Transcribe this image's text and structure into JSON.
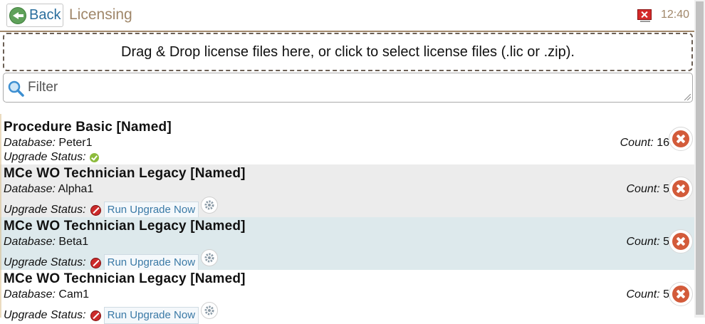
{
  "header": {
    "back_label": "Back",
    "title": "Licensing",
    "clock": "12:40"
  },
  "dropzone": {
    "text": "Drag & Drop license files here, or click to select license files (.lic or .zip)."
  },
  "filter": {
    "placeholder": "Filter",
    "value": ""
  },
  "colors": {
    "accent": "#a0876a",
    "link": "#2a6e9d",
    "selected_row": "#dde9ec",
    "alt_row": "#ececec",
    "remove": "#d35b3a"
  },
  "labels": {
    "database": "Database:",
    "count": "Count:",
    "upgrade_status": "Upgrade Status:",
    "run_upgrade": "Run Upgrade Now"
  },
  "licenses": [
    {
      "name": "Procedure Basic [Named]",
      "database": "Peter1",
      "count": "16",
      "status": "ok"
    },
    {
      "name": "MCe WO Technician Legacy [Named]",
      "database": "Alpha1",
      "count": "5",
      "status": "needs-upgrade"
    },
    {
      "name": "MCe WO Technician Legacy [Named]",
      "database": "Beta1",
      "count": "5",
      "status": "needs-upgrade",
      "selected": true
    },
    {
      "name": "MCe WO Technician Legacy [Named]",
      "database": "Cam1",
      "count": "5",
      "status": "needs-upgrade"
    }
  ]
}
